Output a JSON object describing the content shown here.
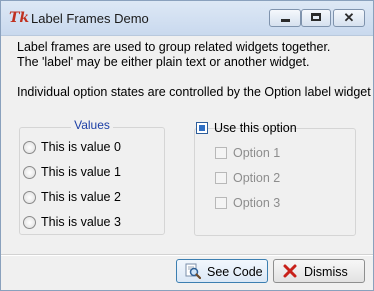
{
  "window": {
    "title": "Label Frames Demo",
    "app_icon_text": "Tk",
    "close_glyph": "✕"
  },
  "messages": {
    "line1": "Label frames are used to group related widgets together.",
    "line2": "The 'label' may be either plain text or another widget.",
    "line3": "Individual option states are controlled by the Option label widget"
  },
  "values_frame": {
    "caption": "Values",
    "options": [
      "This is value 0",
      "This is value 1",
      "This is value 2",
      "This is value 3"
    ]
  },
  "option_frame": {
    "toggle_label": "Use this option",
    "toggle_checked": true,
    "options": [
      "Option 1",
      "Option 2",
      "Option 3"
    ]
  },
  "buttons": {
    "see_code": "See Code",
    "dismiss": "Dismiss"
  },
  "colors": {
    "caption_blue": "#1c3fa6",
    "disabled_text": "#8d8d8d",
    "dismiss_red": "#c8211a"
  },
  "icons": {
    "see_code": "magnifier-icon",
    "dismiss": "red-x-icon"
  }
}
